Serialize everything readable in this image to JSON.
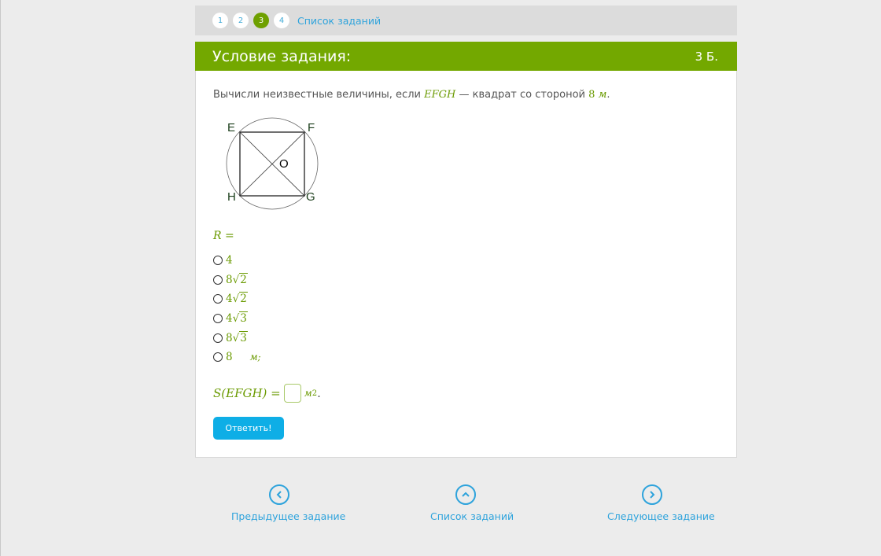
{
  "nav_steps": [
    "1",
    "2",
    "3",
    "4"
  ],
  "active_step": "3",
  "task_list_link": "Список заданий",
  "header": {
    "title": "Условие задания:",
    "score": "3 Б."
  },
  "question": {
    "text_before": "Вычисли неизвестные величины, если ",
    "square_name": "EFGH",
    "text_middle": " — квадрат со стороной ",
    "side": "8",
    "unit": "м",
    "text_end": "."
  },
  "figure": {
    "labels": {
      "e": "E",
      "f": "F",
      "g": "G",
      "h": "H",
      "o": "O"
    },
    "stroke_color": "#222222",
    "label_color": "#1a3d1a"
  },
  "r_label": "R =",
  "options": [
    {
      "coef": "4",
      "radicand": ""
    },
    {
      "coef": "8",
      "radicand": "2"
    },
    {
      "coef": "4",
      "radicand": "2"
    },
    {
      "coef": "4",
      "radicand": "3"
    },
    {
      "coef": "8",
      "radicand": "3"
    },
    {
      "coef": "8",
      "radicand": "",
      "unit_after": "м;"
    }
  ],
  "area": {
    "label": "S(EFGH) =",
    "unit": "м",
    "power": "2",
    "end": "."
  },
  "submit_label": "Ответить!",
  "bottom_nav": {
    "prev": {
      "label": "Предыдущее задание",
      "icon": "chevron-left-icon"
    },
    "list": {
      "label": "Список заданий",
      "icon": "chevron-up-icon"
    },
    "next": {
      "label": "Следующее задание",
      "icon": "chevron-right-icon"
    }
  },
  "colors": {
    "accent_green": "#73a800",
    "link_blue": "#2ea3dc",
    "button_blue": "#0eaee6",
    "math_green": "#6a9a00"
  }
}
